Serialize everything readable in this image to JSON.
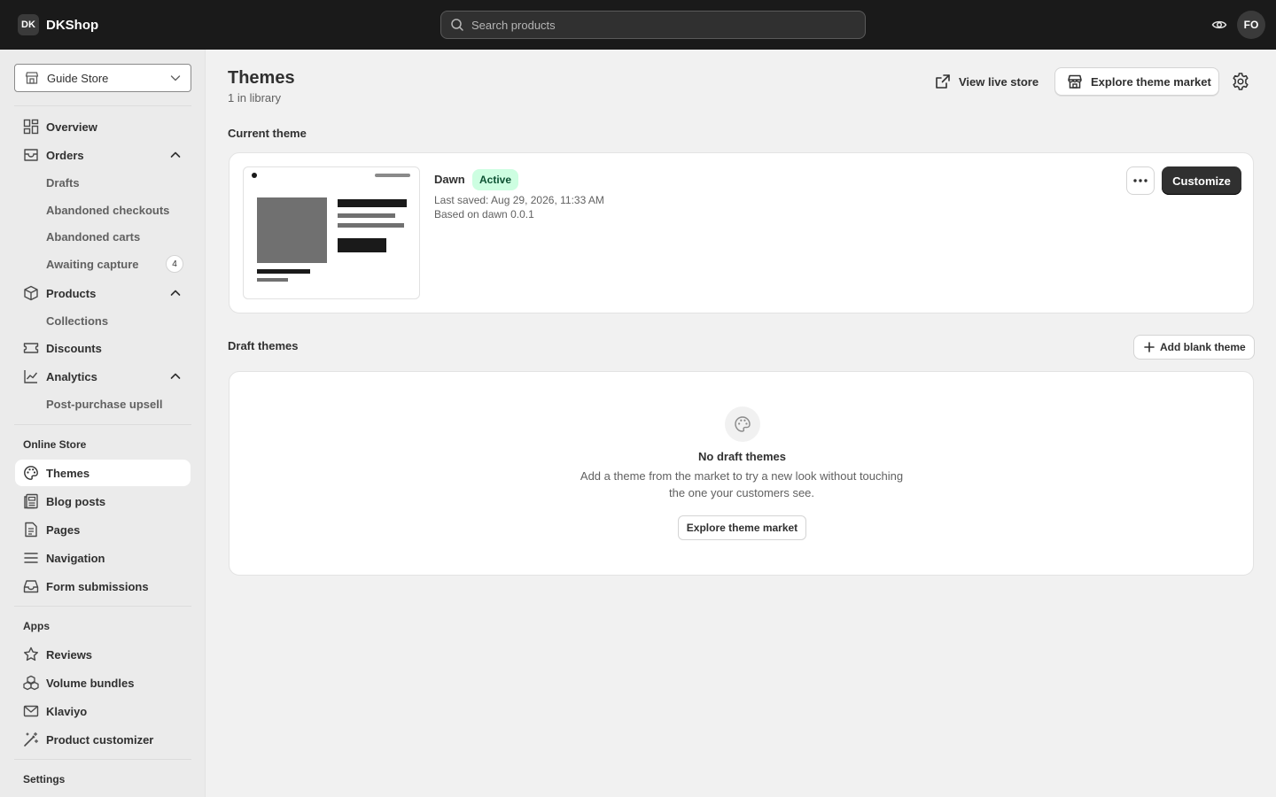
{
  "topbar": {
    "brand_badge": "DK",
    "brand_name": "DKShop",
    "search_placeholder": "Search products",
    "avatar_initials": "FO"
  },
  "sidebar": {
    "store_selector": "Guide Store",
    "nav": {
      "overview": "Overview",
      "orders": "Orders",
      "drafts": "Drafts",
      "abandoned_checkouts": "Abandoned checkouts",
      "abandoned_carts": "Abandoned carts",
      "awaiting_capture": "Awaiting capture",
      "awaiting_capture_count": "4",
      "products": "Products",
      "collections": "Collections",
      "discounts": "Discounts",
      "analytics": "Analytics",
      "post_purchase_upsell": "Post-purchase upsell"
    },
    "online_store": {
      "heading": "Online Store",
      "themes": "Themes",
      "blog_posts": "Blog posts",
      "pages": "Pages",
      "navigation": "Navigation",
      "form_submissions": "Form submissions"
    },
    "apps": {
      "heading": "Apps",
      "reviews": "Reviews",
      "volume_bundles": "Volume bundles",
      "klaviyo": "Klaviyo",
      "product_customizer": "Product customizer"
    },
    "settings_heading": "Settings"
  },
  "main": {
    "title": "Themes",
    "subtitle": "1 in library",
    "view_live_store": "View live store",
    "explore_theme_market": "Explore theme market",
    "current_theme": {
      "heading": "Current theme",
      "name": "Dawn",
      "status": "Active",
      "last_saved": "Last saved: Aug 29, 2026, 11:33 AM",
      "based_on": "Based on dawn 0.0.1",
      "customize_label": "Customize"
    },
    "draft_themes": {
      "heading": "Draft themes",
      "add_blank_label": "Add blank theme",
      "empty_title": "No draft themes",
      "empty_text": "Add a theme from the market to try a new look without touching the one your customers see.",
      "explore_label": "Explore theme market"
    }
  },
  "colors": {
    "topbar_bg": "#1a1a1a",
    "primary_button": "#303030",
    "active_badge_bg": "#cdfee1",
    "active_badge_text": "#0c5132",
    "page_bg": "#f1f1f1"
  }
}
